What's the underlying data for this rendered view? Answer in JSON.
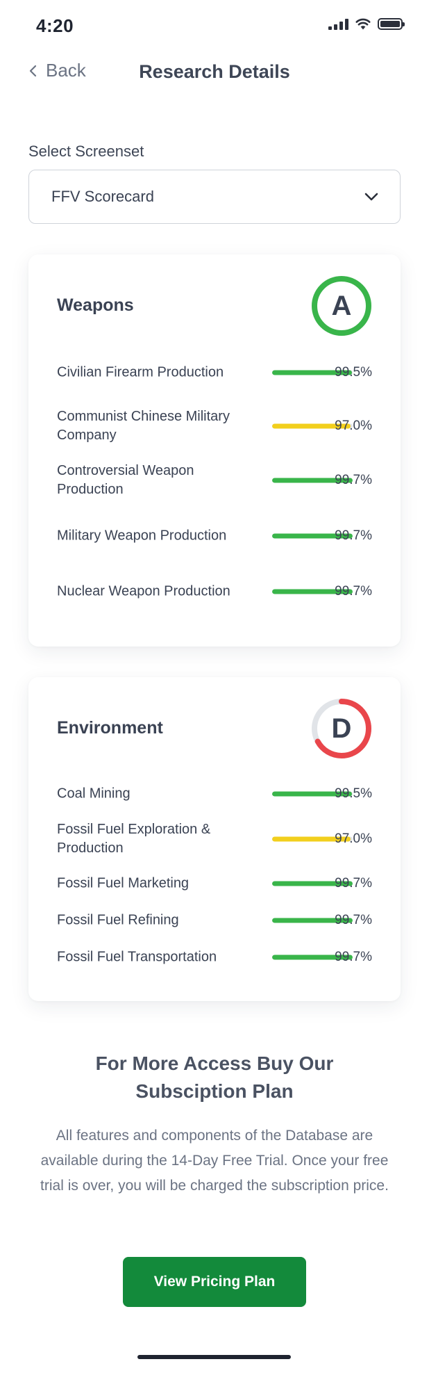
{
  "status_bar": {
    "time": "4:20"
  },
  "nav": {
    "back_label": "Back",
    "title": "Research Details"
  },
  "screenset": {
    "label": "Select Screenset",
    "value": "FFV Scorecard"
  },
  "colors": {
    "green": "#39b54a",
    "yellow": "#f2cf1d",
    "red": "#e9464b",
    "track": "#e1e4e8",
    "cta": "#138a3b"
  },
  "weapons": {
    "title": "Weapons",
    "grade": "A",
    "grade_fraction": 1.0,
    "grade_color": "#39b54a",
    "rows": [
      {
        "name": "Civilian Firearm Production",
        "value": 99.5,
        "pct": "99.5%",
        "color": "#39b54a"
      },
      {
        "name": "Communist Chinese Military Company",
        "value": 97.0,
        "pct": "97.0%",
        "color": "#f2cf1d"
      },
      {
        "name": "Controversial Weapon Production",
        "value": 99.7,
        "pct": "99.7%",
        "color": "#39b54a"
      },
      {
        "name": "Military Weapon Production",
        "value": 99.7,
        "pct": "99.7%",
        "color": "#39b54a"
      },
      {
        "name": "Nuclear Weapon Production",
        "value": 99.7,
        "pct": "99.7%",
        "color": "#39b54a"
      }
    ]
  },
  "environment": {
    "title": "Environment",
    "grade": "D",
    "grade_fraction": 0.67,
    "grade_color": "#e9464b",
    "rows": [
      {
        "name": "Coal Mining",
        "value": 99.5,
        "pct": "99.5%",
        "color": "#39b54a"
      },
      {
        "name": "Fossil Fuel Exploration & Production",
        "value": 97.0,
        "pct": "97.0%",
        "color": "#f2cf1d"
      },
      {
        "name": "Fossil Fuel Marketing",
        "value": 99.7,
        "pct": "99.7%",
        "color": "#39b54a"
      },
      {
        "name": "Fossil Fuel Refining",
        "value": 99.7,
        "pct": "99.7%",
        "color": "#39b54a"
      },
      {
        "name": "Fossil Fuel Transportation",
        "value": 99.7,
        "pct": "99.7%",
        "color": "#39b54a"
      }
    ]
  },
  "promo": {
    "title": "For More Access Buy Our Subsciption Plan",
    "body": "All features and components of the Database are available during the 14-Day Free Trial. Once your free trial is over, you will be charged the subscription price.",
    "cta_label": "View Pricing Plan"
  }
}
